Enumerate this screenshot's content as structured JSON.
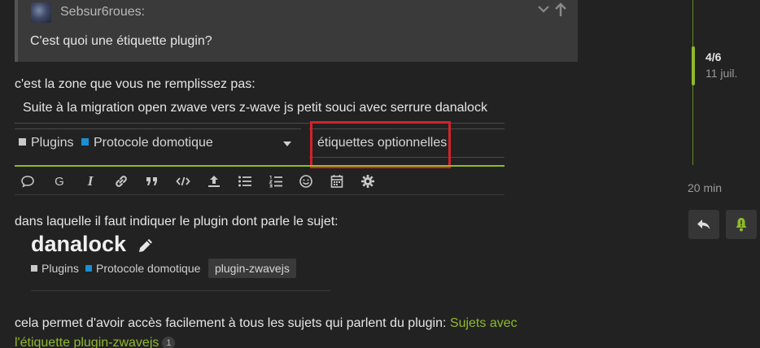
{
  "quote": {
    "username": "Sebsur6roues:",
    "text": "C'est quoi une étiquette plugin?"
  },
  "paragraph1": "c'est la zone que vous ne remplissez pas:",
  "composer": {
    "title_value": "Suite à la migration open zwave vers z-wave js petit souci avec serrure danalock",
    "categories": [
      {
        "name": "Plugins",
        "color": "#c9c9c9"
      },
      {
        "name": "Protocole domotique",
        "color": "#1a8fd4"
      }
    ],
    "tags_placeholder": "étiquettes optionnelles",
    "toolbar_icons": [
      "chat-bubble-icon",
      "g-icon",
      "italic-icon",
      "link-icon",
      "quote-icon",
      "code-icon",
      "upload-icon",
      "bullet-list-icon",
      "numbered-list-icon",
      "emoji-icon",
      "calendar-icon",
      "gear-icon"
    ],
    "g_label": "G",
    "i_label": "I"
  },
  "paragraph2": "dans laquelle il faut indiquer le plugin dont parle le sujet:",
  "preview": {
    "title": "danalock",
    "categories": [
      {
        "name": "Plugins",
        "color": "#c9c9c9"
      },
      {
        "name": "Protocole domotique",
        "color": "#1a8fd4"
      }
    ],
    "tag": "plugin-zwavejs"
  },
  "paragraph3": {
    "text": "cela permet d'avoir accès facilement à tous les sujets qui parlent du plugin: ",
    "link_line1": "Sujets avec",
    "link_line2": "l'étiquette plugin-zwavejs",
    "badge": "1"
  },
  "timeline": {
    "position": "4/6",
    "date": "11 juil.",
    "ago": "20 min"
  },
  "colors": {
    "accent": "#8fba2b",
    "highlight_box": "#d3222a",
    "background": "#222222"
  }
}
